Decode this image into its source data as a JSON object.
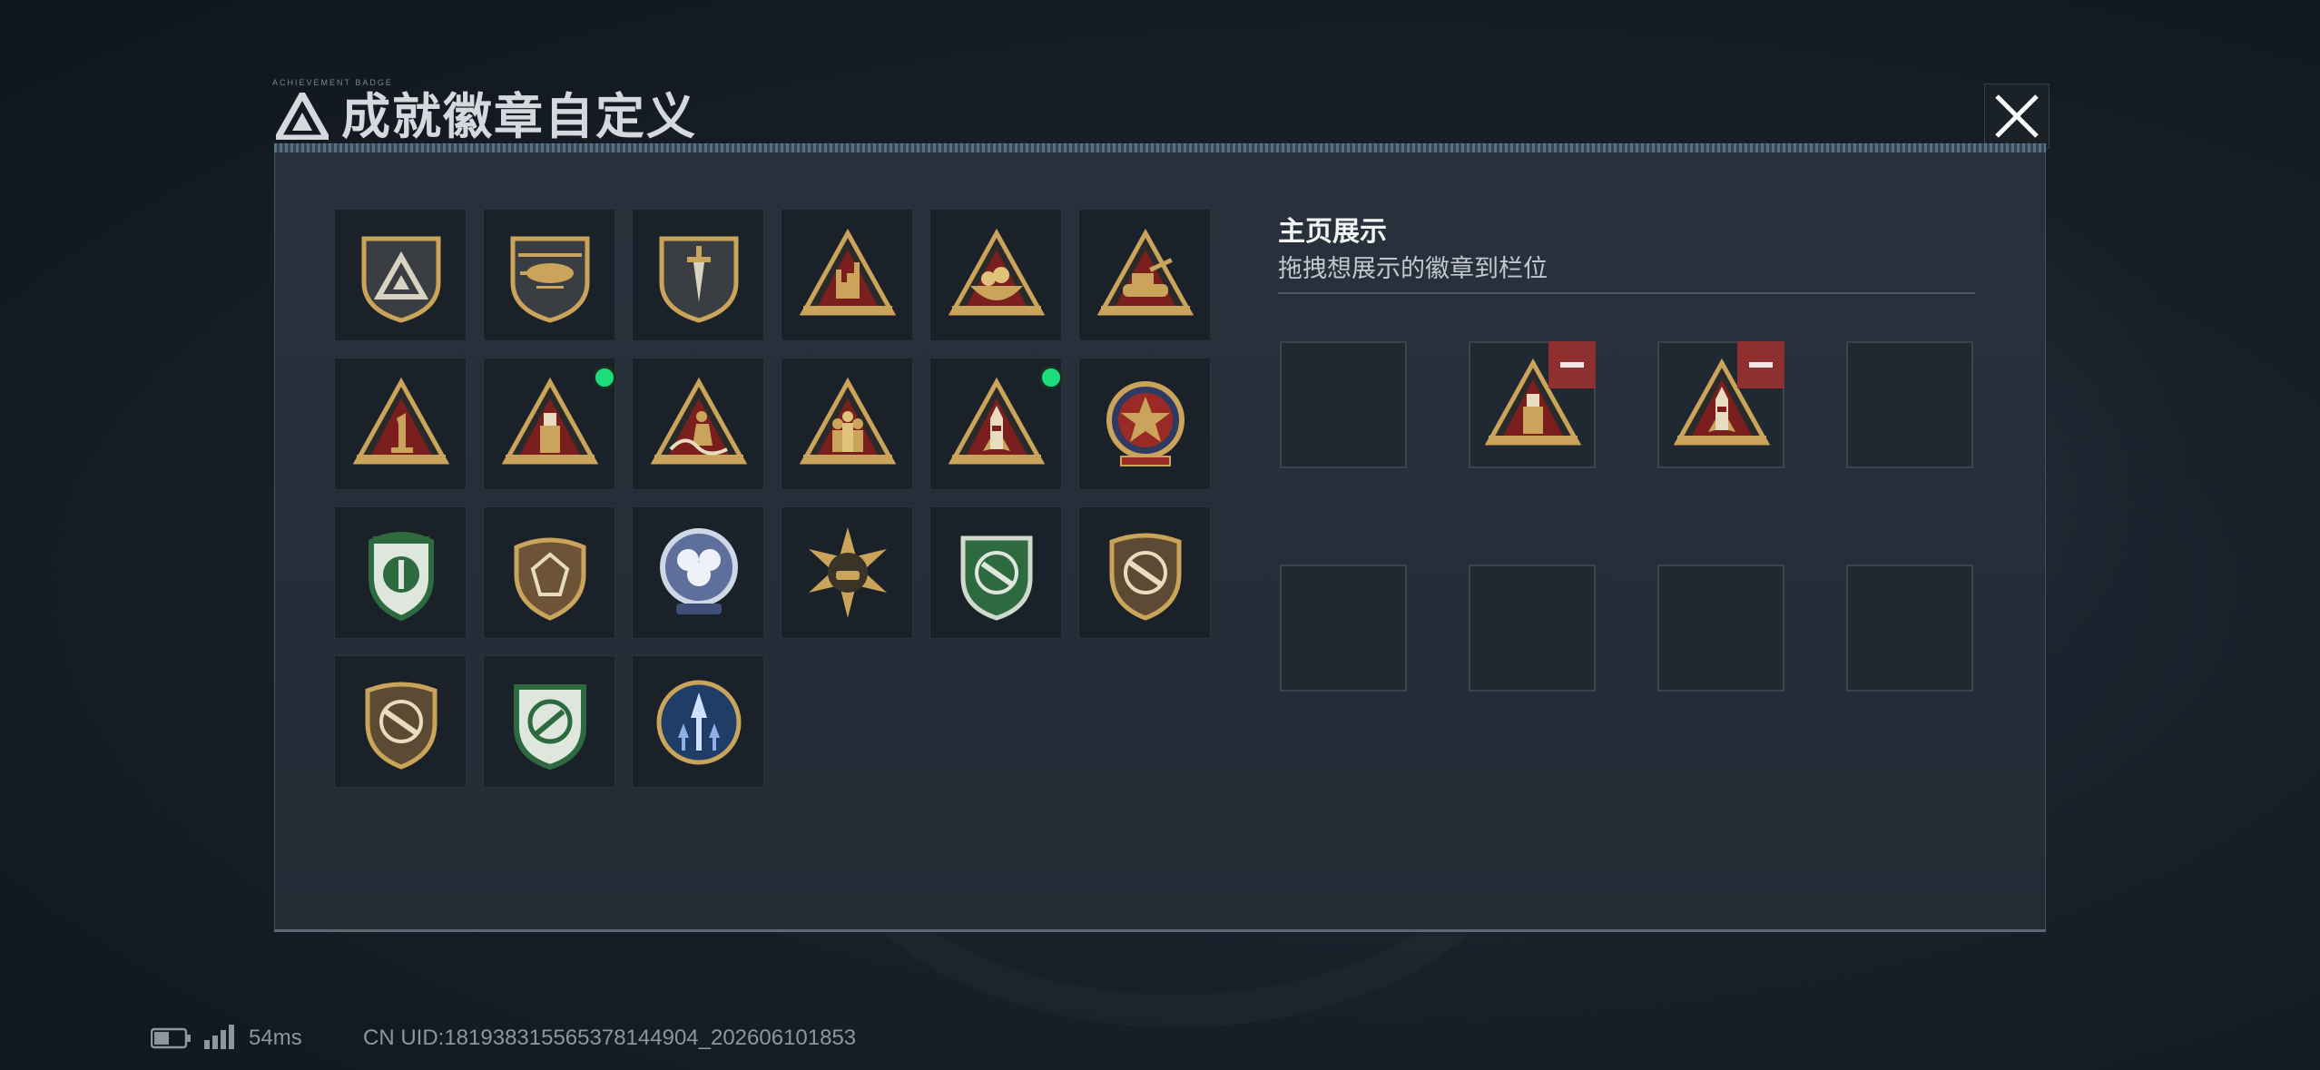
{
  "window": {
    "title": "成就徽章自定义",
    "title_micro": "ACHIEVEMENT BADGE"
  },
  "close_icon": "close-icon",
  "badges": [
    {
      "id": "badge-1",
      "icon": "shield-triangle-emblem",
      "row": 0,
      "col": 0,
      "new": false
    },
    {
      "id": "badge-2",
      "icon": "shield-helicopter-emblem",
      "row": 0,
      "col": 1,
      "new": false
    },
    {
      "id": "badge-3",
      "icon": "shield-dagger-emblem",
      "row": 0,
      "col": 2,
      "new": false
    },
    {
      "id": "badge-4",
      "icon": "triangle-rock-hand-emblem",
      "row": 0,
      "col": 3,
      "new": false
    },
    {
      "id": "badge-5",
      "icon": "triangle-bowl-emblem",
      "row": 0,
      "col": 4,
      "new": false
    },
    {
      "id": "badge-6",
      "icon": "triangle-tank-emblem",
      "row": 0,
      "col": 5,
      "new": false
    },
    {
      "id": "badge-7",
      "icon": "triangle-number-one-emblem",
      "row": 1,
      "col": 0,
      "new": false
    },
    {
      "id": "badge-8",
      "icon": "triangle-usb-emblem",
      "row": 1,
      "col": 1,
      "new": true
    },
    {
      "id": "badge-9",
      "icon": "triangle-surfer-emblem",
      "row": 1,
      "col": 2,
      "new": false
    },
    {
      "id": "badge-10",
      "icon": "triangle-soldiers-emblem",
      "row": 1,
      "col": 3,
      "new": false
    },
    {
      "id": "badge-11",
      "icon": "triangle-rocket-emblem",
      "row": 1,
      "col": 4,
      "new": true
    },
    {
      "id": "badge-12",
      "icon": "round-star-medal-emblem",
      "row": 1,
      "col": 5,
      "new": false
    },
    {
      "id": "badge-13",
      "icon": "green-shield-emblem",
      "row": 2,
      "col": 0,
      "new": false
    },
    {
      "id": "badge-14",
      "icon": "brown-shield-gem-emblem",
      "row": 2,
      "col": 1,
      "new": false
    },
    {
      "id": "badge-15",
      "icon": "blue-round-flower-emblem",
      "row": 2,
      "col": 2,
      "new": false
    },
    {
      "id": "badge-16",
      "icon": "star-burst-tank-emblem",
      "row": 2,
      "col": 3,
      "new": false
    },
    {
      "id": "badge-17",
      "icon": "green-crosshair-rifle-emblem",
      "row": 2,
      "col": 4,
      "new": false
    },
    {
      "id": "badge-18",
      "icon": "brown-rifle-shield-emblem",
      "row": 2,
      "col": 5,
      "new": false
    },
    {
      "id": "badge-19",
      "icon": "brown-rifle-shield-emblem",
      "row": 3,
      "col": 0,
      "new": false
    },
    {
      "id": "badge-20",
      "icon": "green-crosshair-knife-emblem",
      "row": 3,
      "col": 1,
      "new": false
    },
    {
      "id": "badge-21",
      "icon": "blue-arrow-round-emblem",
      "row": 3,
      "col": 2,
      "new": false
    }
  ],
  "showcase": {
    "title": "主页展示",
    "subtitle": "拖拽想展示的徽章到栏位",
    "slots": [
      {
        "index": 0,
        "badge": null
      },
      {
        "index": 1,
        "badge": "triangle-usb-emblem"
      },
      {
        "index": 2,
        "badge": "triangle-rocket-emblem"
      },
      {
        "index": 3,
        "badge": null
      },
      {
        "index": 4,
        "badge": null
      },
      {
        "index": 5,
        "badge": null
      },
      {
        "index": 6,
        "badge": null
      },
      {
        "index": 7,
        "badge": null
      }
    ],
    "remove_icon": "minus-icon"
  },
  "status": {
    "ping": "54ms",
    "uid": "CN UID:181938315565378144904_202606101853",
    "battery_icon": "battery-icon",
    "signal_icon": "signal-icon"
  },
  "colors": {
    "new_dot": "#1fdc7a",
    "remove": "#8e2f30",
    "gold": "#c9a45a",
    "panel": "#252d37"
  }
}
